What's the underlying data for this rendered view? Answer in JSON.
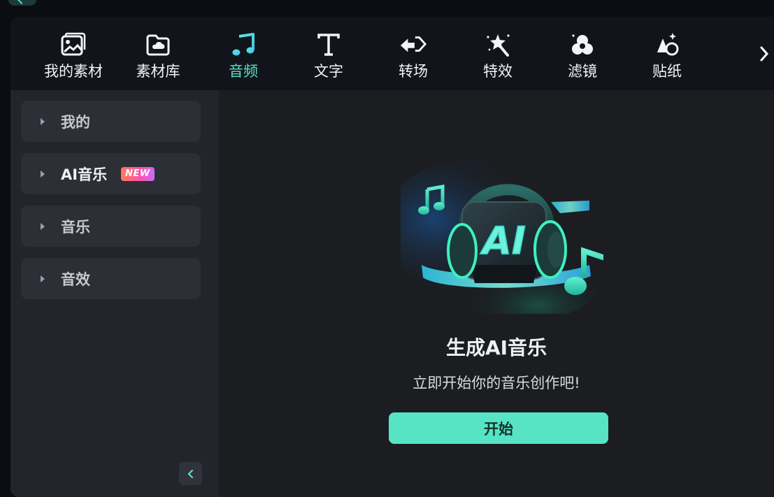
{
  "toolbar": {
    "items": [
      {
        "label": "我的素材",
        "icon": "image-icon",
        "active": false
      },
      {
        "label": "素材库",
        "icon": "folder-cloud-icon",
        "active": false
      },
      {
        "label": "音频",
        "icon": "music-note-icon",
        "active": true
      },
      {
        "label": "文字",
        "icon": "text-icon",
        "active": false
      },
      {
        "label": "转场",
        "icon": "transition-icon",
        "active": false
      },
      {
        "label": "特效",
        "icon": "magic-wand-icon",
        "active": false
      },
      {
        "label": "滤镜",
        "icon": "filter-icon",
        "active": false
      },
      {
        "label": "贴纸",
        "icon": "sticker-icon",
        "active": false
      }
    ],
    "next_icon": "chevron-right-icon"
  },
  "sidebar": {
    "categories": [
      {
        "label": "我的"
      },
      {
        "label": "AI音乐",
        "badge": "NEW"
      },
      {
        "label": "音乐"
      },
      {
        "label": "音效"
      }
    ],
    "collapse_icon": "chevron-left-icon"
  },
  "main": {
    "hero_text": "AI",
    "title": "生成AI音乐",
    "subtitle": "立即开始你的音乐创作吧!",
    "start_button": "开始"
  },
  "colors": {
    "accent": "#56e4c4",
    "active_label": "#5ce0c0",
    "toolbar_bg": "#11151b",
    "sidebar_bg": "#22252b",
    "main_bg": "#1b1d21",
    "badge_gradient": [
      "#ff7a59",
      "#ff4fb0",
      "#c86bff"
    ]
  }
}
